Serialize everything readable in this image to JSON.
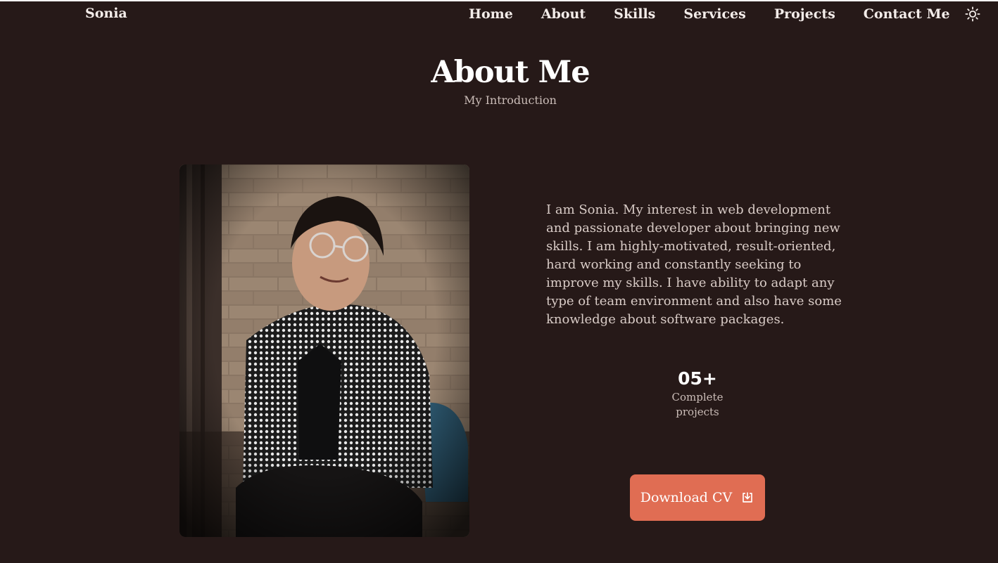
{
  "header": {
    "logo": "Sonia",
    "nav": [
      "Home",
      "About",
      "Skills",
      "Services",
      "Projects",
      "Contact Me"
    ],
    "theme_icon": "sun-icon"
  },
  "about": {
    "title": "About Me",
    "subtitle": "My Introduction",
    "photo_alt": "portrait-photo",
    "description": "I am Sonia. My interest in web development and passionate developer about bringing new skills. I am highly-motivated, result-oriented, hard working and constantly seeking to improve my skills. I have ability to adapt any type of team environment and also have some knowledge about software packages.",
    "stat": {
      "number": "05+",
      "label": "Complete projects"
    },
    "download_button": {
      "label": "Download CV",
      "icon": "download-icon"
    }
  },
  "colors": {
    "background": "#261918",
    "accent": "#e06d53",
    "text": "#f3ece9",
    "muted": "#cbbdb8"
  }
}
